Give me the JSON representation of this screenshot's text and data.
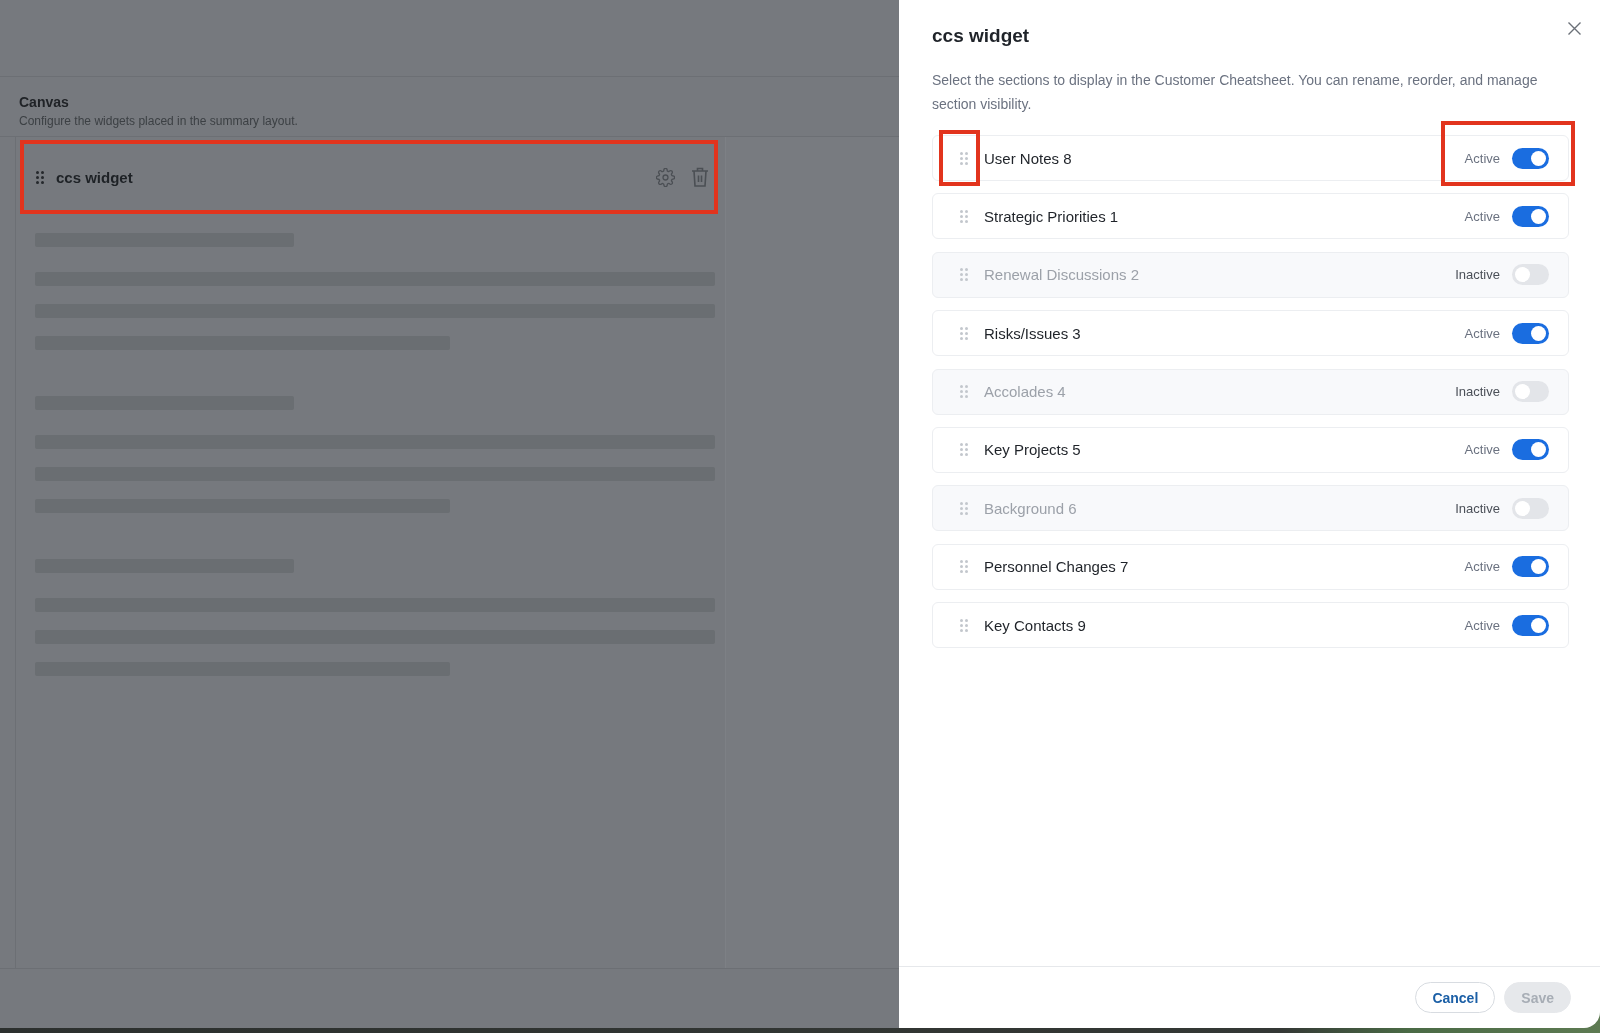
{
  "canvas": {
    "title": "Canvas",
    "description": "Configure the widgets placed in the summary layout.",
    "widget": {
      "name": "ccs widget",
      "highlighted": true
    }
  },
  "drawer": {
    "title": "ccs widget",
    "description": "Select the sections to display in the Customer Cheatsheet. You can rename, reorder, and manage section visibility.",
    "sections": [
      {
        "name": "User Notes 8",
        "status": "Active",
        "active": true,
        "handle_highlighted": true,
        "toggle_highlighted": true
      },
      {
        "name": "Strategic Priorities 1",
        "status": "Active",
        "active": true,
        "handle_highlighted": false,
        "toggle_highlighted": false
      },
      {
        "name": "Renewal Discussions 2",
        "status": "Inactive",
        "active": false,
        "handle_highlighted": false,
        "toggle_highlighted": false
      },
      {
        "name": "Risks/Issues 3",
        "status": "Active",
        "active": true,
        "handle_highlighted": false,
        "toggle_highlighted": false
      },
      {
        "name": "Accolades 4",
        "status": "Inactive",
        "active": false,
        "handle_highlighted": false,
        "toggle_highlighted": false
      },
      {
        "name": "Key Projects 5",
        "status": "Active",
        "active": true,
        "handle_highlighted": false,
        "toggle_highlighted": false
      },
      {
        "name": "Background 6",
        "status": "Inactive",
        "active": false,
        "handle_highlighted": false,
        "toggle_highlighted": false
      },
      {
        "name": "Personnel Changes 7",
        "status": "Active",
        "active": true,
        "handle_highlighted": false,
        "toggle_highlighted": false
      },
      {
        "name": "Key Contacts 9",
        "status": "Active",
        "active": true,
        "handle_highlighted": false,
        "toggle_highlighted": false
      }
    ],
    "buttons": [
      {
        "label": "Cancel",
        "kind": "secondary",
        "disabled": false
      },
      {
        "label": "Save",
        "kind": "primary",
        "disabled": true
      }
    ]
  }
}
